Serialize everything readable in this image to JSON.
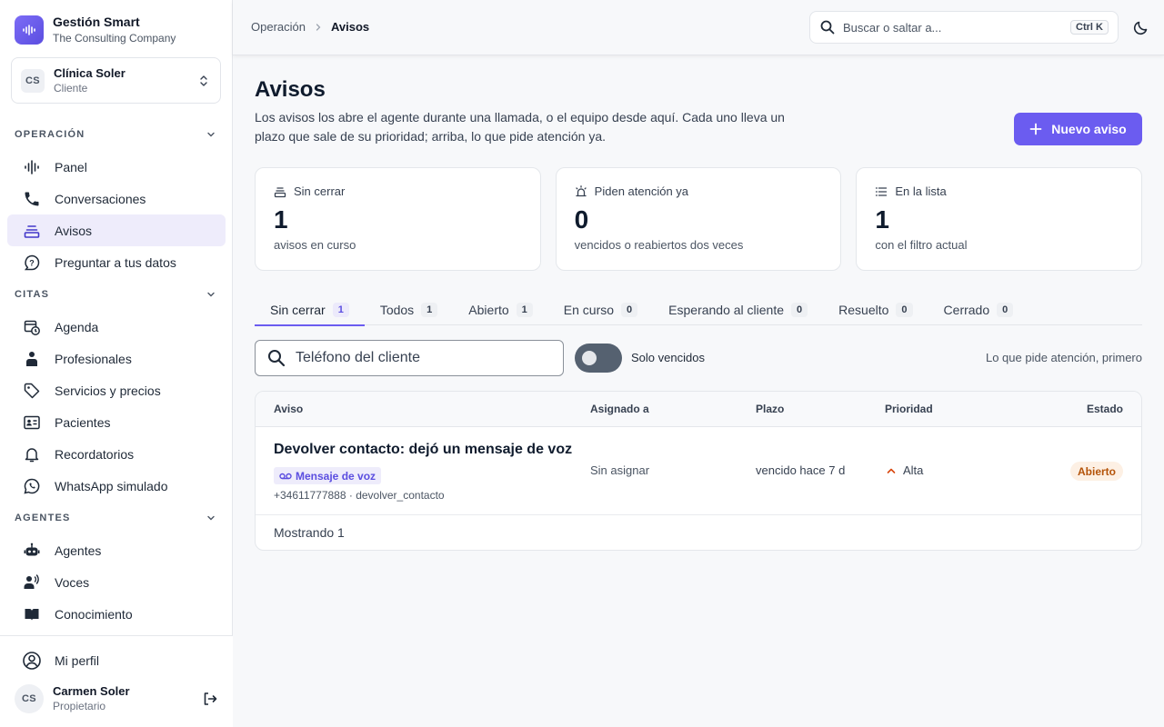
{
  "app": {
    "name": "Gestión Smart",
    "company": "The Consulting Company",
    "accent": "#6b5cf0"
  },
  "tenant": {
    "initials": "CS",
    "name": "Clínica Soler",
    "role": "Cliente"
  },
  "sidebar": {
    "sections": [
      {
        "title": "OPERACIÓN",
        "items": [
          {
            "label": "Panel",
            "icon": "waveform-icon"
          },
          {
            "label": "Conversaciones",
            "icon": "phone-icon"
          },
          {
            "label": "Avisos",
            "icon": "queue-icon",
            "active": true
          },
          {
            "label": "Preguntar a tus datos",
            "icon": "chat-question-icon"
          }
        ]
      },
      {
        "title": "CITAS",
        "items": [
          {
            "label": "Agenda",
            "icon": "calendar-clock-icon"
          },
          {
            "label": "Profesionales",
            "icon": "person-icon"
          },
          {
            "label": "Servicios y precios",
            "icon": "tag-icon"
          },
          {
            "label": "Pacientes",
            "icon": "id-card-icon"
          },
          {
            "label": "Recordatorios",
            "icon": "bell-icon"
          },
          {
            "label": "WhatsApp simulado",
            "icon": "whatsapp-icon"
          }
        ]
      },
      {
        "title": "AGENTES",
        "items": [
          {
            "label": "Agentes",
            "icon": "robot-icon"
          },
          {
            "label": "Voces",
            "icon": "voice-icon"
          },
          {
            "label": "Conocimiento",
            "icon": "book-icon"
          }
        ]
      }
    ],
    "profile_link": "Mi perfil",
    "user": {
      "initials": "CS",
      "name": "Carmen Soler",
      "role": "Propietario"
    }
  },
  "topbar": {
    "breadcrumb": {
      "parent": "Operación",
      "current": "Avisos"
    },
    "search": {
      "placeholder": "Buscar o saltar a...",
      "shortcut": "Ctrl K"
    }
  },
  "page": {
    "title": "Avisos",
    "description": "Los avisos los abre el agente durante una llamada, o el equipo desde aquí. Cada uno lleva un plazo que sale de su prioridad; arriba, lo que pide atención ya.",
    "new_button": "Nuevo aviso"
  },
  "stats": [
    {
      "label": "Sin cerrar",
      "value": "1",
      "caption": "avisos en curso",
      "icon": "inbox-icon"
    },
    {
      "label": "Piden atención ya",
      "value": "0",
      "caption": "vencidos o reabiertos dos veces",
      "icon": "siren-icon"
    },
    {
      "label": "En la lista",
      "value": "1",
      "caption": "con el filtro actual",
      "icon": "list-icon"
    }
  ],
  "tabs": [
    {
      "label": "Sin cerrar",
      "count": "1",
      "active": true
    },
    {
      "label": "Todos",
      "count": "1"
    },
    {
      "label": "Abierto",
      "count": "1"
    },
    {
      "label": "En curso",
      "count": "0"
    },
    {
      "label": "Esperando al cliente",
      "count": "0"
    },
    {
      "label": "Resuelto",
      "count": "0"
    },
    {
      "label": "Cerrado",
      "count": "0"
    }
  ],
  "filters": {
    "phone_placeholder": "Teléfono del cliente",
    "overdue_toggle_label": "Solo vencidos",
    "overdue_only": false,
    "sort_label": "Lo que pide atención, primero"
  },
  "table": {
    "columns": {
      "notice": "Aviso",
      "assigned": "Asignado a",
      "due": "Plazo",
      "priority": "Prioridad",
      "status": "Estado"
    },
    "rows": [
      {
        "title": "Devolver contacto: dejó un mensaje de voz",
        "channel": "Mensaje de voz",
        "meta": "+34611777888 · devolver_contacto",
        "assigned": "Sin asignar",
        "due": "vencido hace 7 d",
        "priority": "Alta",
        "status": "Abierto"
      }
    ],
    "footer": "Mostrando 1"
  }
}
